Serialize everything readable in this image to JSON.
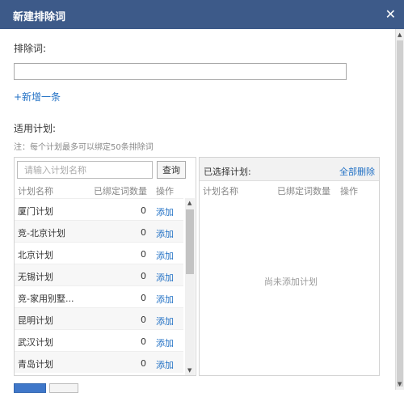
{
  "dialog": {
    "title": "新建排除词",
    "close_icon": "close-icon"
  },
  "form": {
    "exclude_label": "排除词:",
    "exclude_value": "",
    "add_more": "+新增一条",
    "plan_label": "适用计划:",
    "note": "注：每个计划最多可以绑定50条排除词"
  },
  "left_panel": {
    "search_placeholder": "请输入计划名称",
    "search_value": "",
    "search_button": "查询",
    "columns": [
      "计划名称",
      "已绑定词数量",
      "操作"
    ],
    "rows": [
      {
        "name": "厦门计划",
        "count": "0",
        "action": "添加"
      },
      {
        "name": "竞-北京计划",
        "count": "0",
        "action": "添加"
      },
      {
        "name": "北京计划",
        "count": "0",
        "action": "添加"
      },
      {
        "name": "无锡计划",
        "count": "0",
        "action": "添加"
      },
      {
        "name": "竞-家用别墅...",
        "count": "0",
        "action": "添加"
      },
      {
        "name": "昆明计划",
        "count": "0",
        "action": "添加"
      },
      {
        "name": "武汉计划",
        "count": "0",
        "action": "添加"
      },
      {
        "name": "青岛计划",
        "count": "0",
        "action": "添加"
      }
    ]
  },
  "right_panel": {
    "title": "已选择计划:",
    "delete_all": "全部删除",
    "columns": [
      "计划名称",
      "已绑定词数量",
      "操作"
    ],
    "empty_text": "尚未添加计划"
  },
  "colors": {
    "title_bar": "#3d5a89",
    "link": "#1f6fc4",
    "primary_button": "#3f77c9"
  }
}
